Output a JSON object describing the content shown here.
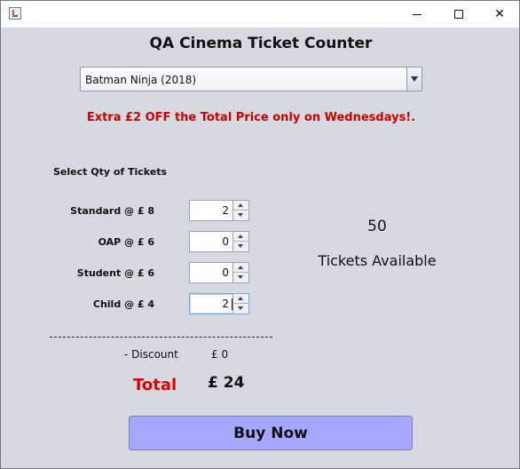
{
  "window": {
    "icon": "java-app-icon",
    "controls": [
      "minimize-icon",
      "maximize-icon",
      "close-icon"
    ],
    "close_glyph": "✕"
  },
  "title": "QA Cinema Ticket Counter",
  "movie_select": {
    "value": "Batman Ninja (2018)"
  },
  "promo": "Extra £2 OFF the Total Price only on Wednesdays!.",
  "qty_heading": "Select Qty of Tickets",
  "tickets": [
    {
      "label": "Standard @ £  8",
      "qty": "2"
    },
    {
      "label": "OAP @ £  6",
      "qty": "0"
    },
    {
      "label": "Student @ £  6",
      "qty": "0"
    },
    {
      "label": "Child @ £  4",
      "qty": "2"
    }
  ],
  "availability": {
    "count": "50",
    "label": "Tickets Available"
  },
  "discount": {
    "label": "- Discount",
    "value": "£  0"
  },
  "total": {
    "label": "Total",
    "value": "£  24"
  },
  "buy_button": "Buy Now",
  "colors": {
    "promo": "#cc0000",
    "total_label": "#dd0000",
    "buy_button": "#a7a7ff",
    "background": "#d6d9df"
  }
}
